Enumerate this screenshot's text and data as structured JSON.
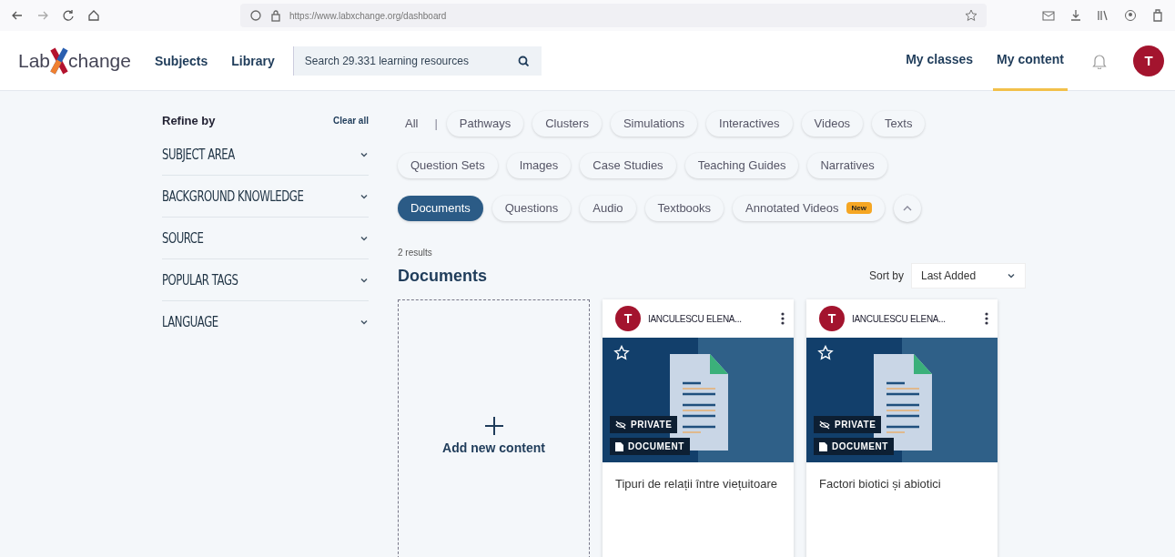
{
  "browser": {
    "url": "https://www.labxchange.org/dashboard"
  },
  "header": {
    "logo": {
      "left": "Lab",
      "right": "change"
    },
    "nav": [
      {
        "label": "Subjects"
      },
      {
        "label": "Library"
      }
    ],
    "search": {
      "placeholder": "Search 29.331 learning resources"
    },
    "user_nav": [
      {
        "label": "My classes",
        "selected": false
      },
      {
        "label": "My content",
        "selected": true
      }
    ],
    "avatar": "T"
  },
  "sidebar": {
    "title": "Refine by",
    "clear": "Clear all",
    "sections": [
      {
        "label": "SUBJECT AREA",
        "expanded": false
      },
      {
        "label": "BACKGROUND KNOWLEDGE",
        "expanded": false
      },
      {
        "label": "SOURCE",
        "expanded": false
      },
      {
        "label": "POPULAR TAGS",
        "expanded": false
      },
      {
        "label": "LANGUAGE",
        "expanded": false
      }
    ]
  },
  "filters": [
    {
      "kind": "plain",
      "label": "All",
      "selected": false
    },
    {
      "kind": "divider",
      "label": "|"
    },
    {
      "kind": "chip",
      "label": "Pathways",
      "selected": false
    },
    {
      "kind": "chip",
      "label": "Clusters",
      "selected": false
    },
    {
      "kind": "chip",
      "label": "Simulations",
      "selected": false
    },
    {
      "kind": "chip",
      "label": "Interactives",
      "selected": false
    },
    {
      "kind": "chip",
      "label": "Videos",
      "selected": false
    },
    {
      "kind": "chip",
      "label": "Texts",
      "selected": false
    },
    {
      "kind": "break"
    },
    {
      "kind": "chip",
      "label": "Question Sets",
      "selected": false
    },
    {
      "kind": "chip",
      "label": "Images",
      "selected": false
    },
    {
      "kind": "chip",
      "label": "Case Studies",
      "selected": false
    },
    {
      "kind": "chip",
      "label": "Teaching Guides",
      "selected": false
    },
    {
      "kind": "chip",
      "label": "Narratives",
      "selected": false
    },
    {
      "kind": "break"
    },
    {
      "kind": "chip",
      "label": "Documents",
      "selected": true
    },
    {
      "kind": "chip",
      "label": "Questions",
      "selected": false
    },
    {
      "kind": "chip",
      "label": "Audio",
      "selected": false
    },
    {
      "kind": "chip",
      "label": "Textbooks",
      "selected": false
    },
    {
      "kind": "chip",
      "label": "Annotated Videos",
      "selected": false,
      "badge": "New"
    },
    {
      "kind": "collapse"
    }
  ],
  "results": {
    "count": "2 results",
    "title": "Documents",
    "sort": {
      "label": "Sort by",
      "value": "Last Added"
    },
    "add": {
      "label": "Add new content"
    },
    "cards": [
      {
        "initial": "T",
        "author": "IANCULESCU ELENA...",
        "visibility": "PRIVATE",
        "type": "DOCUMENT",
        "title": "Tipuri de relații între viețuitoare"
      },
      {
        "initial": "T",
        "author": "IANCULESCU ELENA...",
        "visibility": "PRIVATE",
        "type": "DOCUMENT",
        "title": "Factori biotici și abiotici"
      }
    ]
  }
}
